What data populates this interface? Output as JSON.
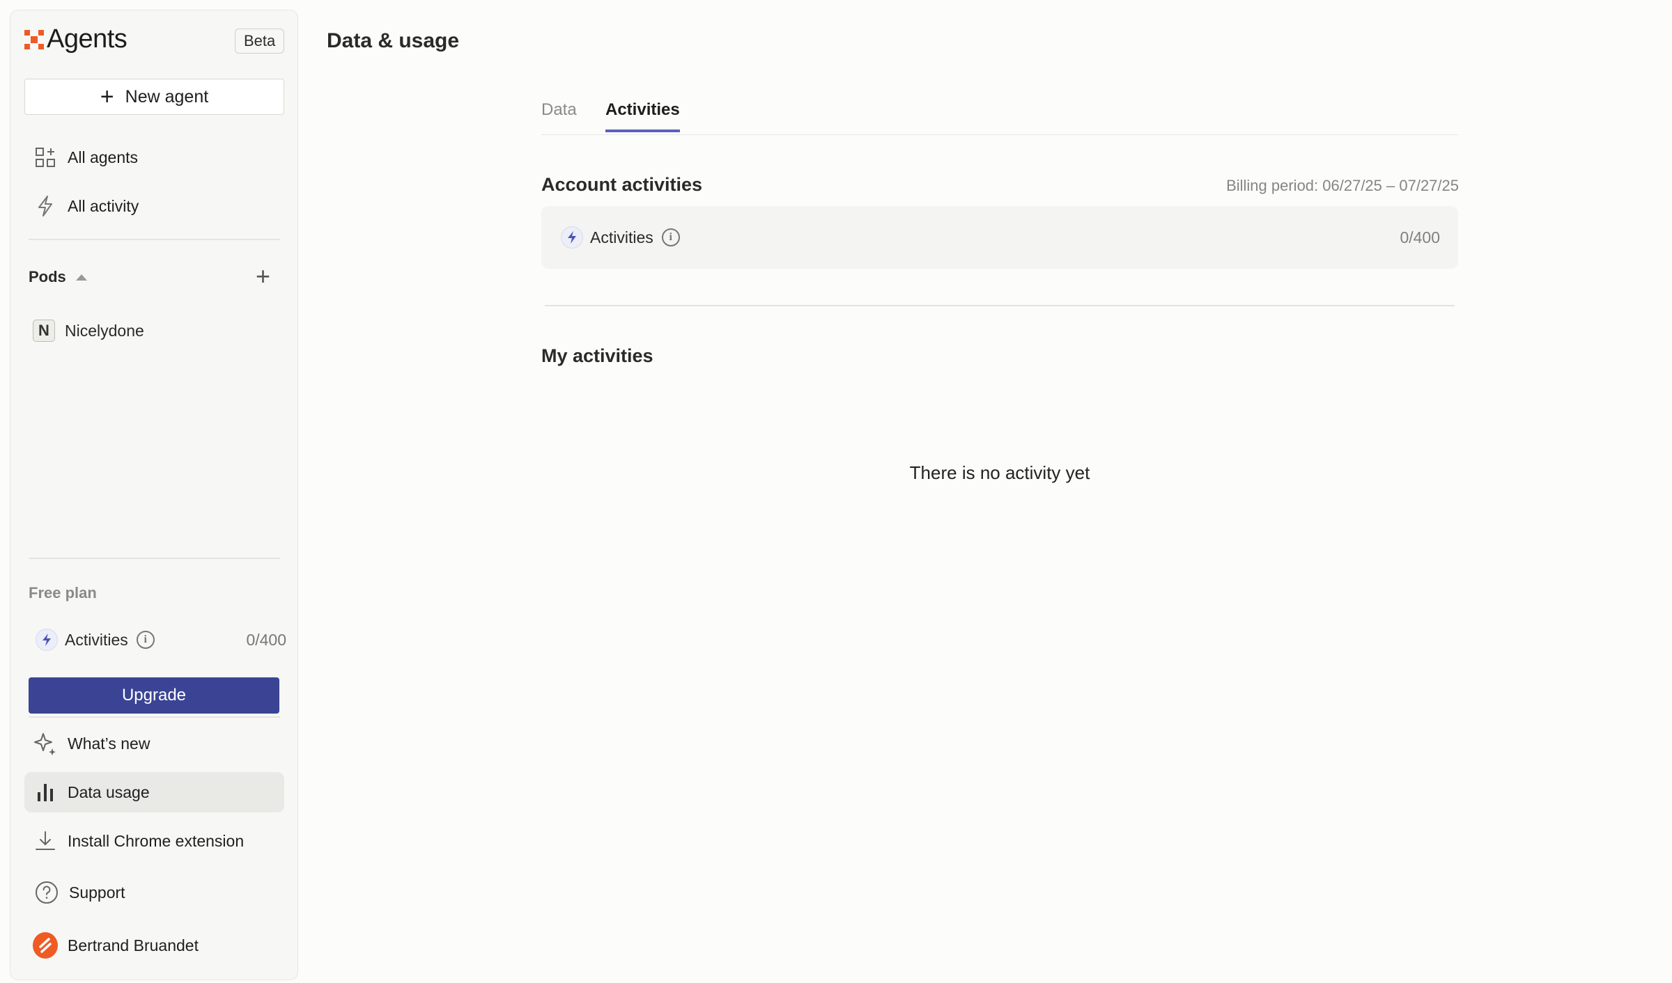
{
  "sidebar": {
    "logo_text": "Agents",
    "beta_badge": "Beta",
    "new_agent_label": "New agent",
    "nav": [
      {
        "label": "All agents",
        "icon": "grid-plus-icon"
      },
      {
        "label": "All activity",
        "icon": "lightning-icon"
      }
    ],
    "pods": {
      "label": "Pods",
      "items": [
        {
          "initial": "N",
          "name": "Nicelydone"
        }
      ]
    },
    "plan": {
      "label": "Free plan",
      "activities_label": "Activities",
      "activities_count": "0/400",
      "upgrade_label": "Upgrade"
    },
    "footer_nav": [
      {
        "label": "What’s new",
        "icon": "sparkle-icon"
      },
      {
        "label": "Data usage",
        "icon": "bar-chart-icon",
        "active": true
      },
      {
        "label": "Install Chrome extension",
        "icon": "download-icon"
      },
      {
        "label": "Support",
        "icon": "help-circle-icon"
      }
    ],
    "user": {
      "name": "Bertrand Bruandet"
    }
  },
  "main": {
    "title": "Data & usage",
    "tabs": [
      {
        "label": "Data",
        "active": false
      },
      {
        "label": "Activities",
        "active": true
      }
    ],
    "account": {
      "title": "Account activities",
      "billing_period": "Billing period: 06/27/25 – 07/27/25",
      "card_label": "Activities",
      "card_count": "0/400"
    },
    "my_activities": {
      "title": "My activities",
      "empty_text": "There is no activity yet"
    }
  },
  "colors": {
    "accent": "#3b4494",
    "tab_underline": "#5963ba",
    "brand_orange": "#ee5b24"
  }
}
